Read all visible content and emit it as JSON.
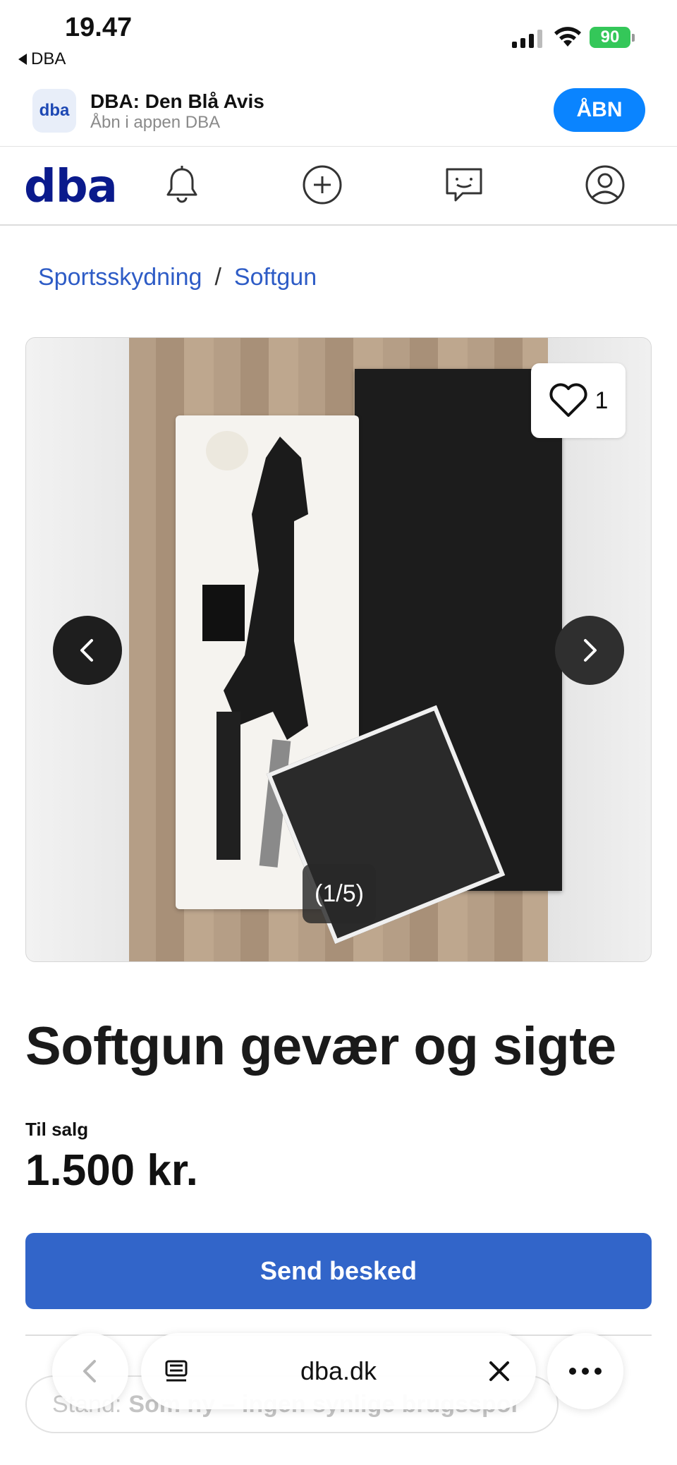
{
  "status_bar": {
    "time": "19.47",
    "back_app": "DBA",
    "battery": "90"
  },
  "app_banner": {
    "icon_text": "dba",
    "title": "DBA: Den Blå Avis",
    "subtitle": "Åbn i appen DBA",
    "open_label": "ÅBN"
  },
  "nav": {
    "logo": "dba",
    "icons": [
      "bell-icon",
      "plus-circle-icon",
      "message-icon",
      "profile-icon"
    ]
  },
  "breadcrumb": {
    "items": [
      "Sportsskydning",
      "Softgun"
    ],
    "separator": "/"
  },
  "gallery": {
    "likes": "1",
    "counter": "(1/5)"
  },
  "listing": {
    "title": "Softgun gevær og sigte",
    "sale_label": "Til salg",
    "price": "1.500 kr.",
    "send_label": "Send besked"
  },
  "condition": {
    "label": "Stand:",
    "value": "Som ny – ingen synlige brugsspor"
  },
  "safari": {
    "url": "dba.dk"
  },
  "colors": {
    "brand": "#0a1a8c",
    "link": "#2e5cc6",
    "primary_button": "#3265c9",
    "open_button": "#0a84ff"
  }
}
